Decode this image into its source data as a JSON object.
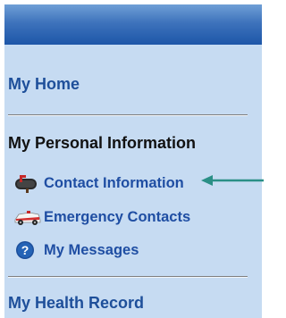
{
  "sidebar": {
    "sections": {
      "home": {
        "label": "My Home"
      },
      "personal": {
        "title": "My Personal Information"
      },
      "health": {
        "label": "My Health Record"
      }
    },
    "items": [
      {
        "label": "Contact Information",
        "icon": "mailbox-icon"
      },
      {
        "label": "Emergency Contacts",
        "icon": "ambulance-icon"
      },
      {
        "label": "My Messages",
        "icon": "help-icon"
      }
    ]
  },
  "colors": {
    "panel_background": "#c6dbf2",
    "header_bar": "#2a63b0",
    "link": "#1e4f9a",
    "arrow": "#2a8f86"
  }
}
